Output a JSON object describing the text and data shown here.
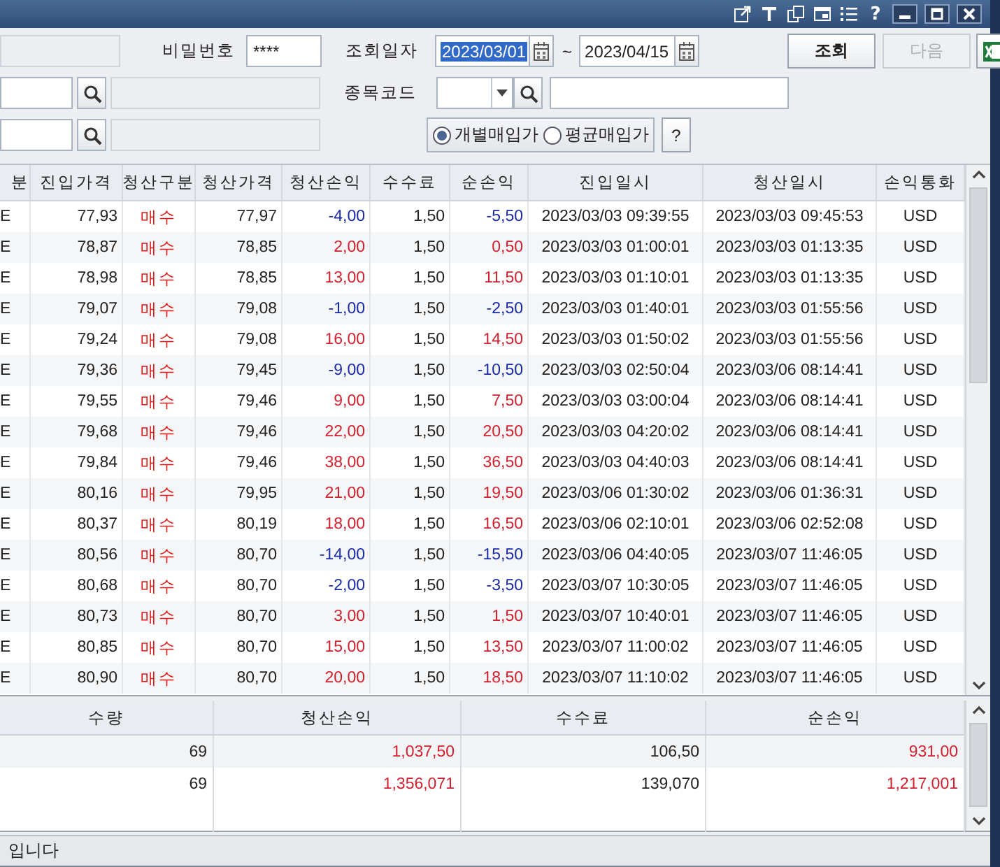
{
  "window": {
    "help": "?"
  },
  "query": {
    "password_label": "비밀번호",
    "password": "****",
    "date_label": "조회일자",
    "date_from": {
      "value": "2023/03/01",
      "highlighted": true
    },
    "date_separator": "~",
    "date_to": {
      "value": "2023/04/15",
      "highlighted": false
    },
    "search_button": "조회",
    "next_button": {
      "label": "다음",
      "disabled": true
    },
    "symbol_label": "종목코드",
    "price_options": [
      {
        "label": "개별매입가",
        "selected": true
      },
      {
        "label": "평균매입가",
        "selected": false
      }
    ],
    "help_button": "?"
  },
  "trades": {
    "columns": [
      "분",
      "진입가격",
      "청산구분",
      "청산가격",
      "청산손익",
      "수수료",
      "순손익",
      "진입일시",
      "청산일시",
      "손익통화"
    ],
    "rows": [
      {
        "cells": [
          "E",
          "77,93",
          "매수",
          "77,97",
          "-4,00",
          "1,50",
          "-5,50",
          "2023/03/03 09:39:55",
          "2023/03/03 09:45:53",
          "USD"
        ],
        "loss": true
      },
      {
        "cells": [
          "E",
          "78,87",
          "매수",
          "78,85",
          "2,00",
          "1,50",
          "0,50",
          "2023/03/03 01:00:01",
          "2023/03/03 01:13:35",
          "USD"
        ],
        "loss": false
      },
      {
        "cells": [
          "E",
          "78,98",
          "매수",
          "78,85",
          "13,00",
          "1,50",
          "11,50",
          "2023/03/03 01:10:01",
          "2023/03/03 01:13:35",
          "USD"
        ],
        "loss": false
      },
      {
        "cells": [
          "E",
          "79,07",
          "매수",
          "79,08",
          "-1,00",
          "1,50",
          "-2,50",
          "2023/03/03 01:40:01",
          "2023/03/03 01:55:56",
          "USD"
        ],
        "loss": true
      },
      {
        "cells": [
          "E",
          "79,24",
          "매수",
          "79,08",
          "16,00",
          "1,50",
          "14,50",
          "2023/03/03 01:50:02",
          "2023/03/03 01:55:56",
          "USD"
        ],
        "loss": false
      },
      {
        "cells": [
          "E",
          "79,36",
          "매수",
          "79,45",
          "-9,00",
          "1,50",
          "-10,50",
          "2023/03/03 02:50:04",
          "2023/03/06 08:14:41",
          "USD"
        ],
        "loss": true
      },
      {
        "cells": [
          "E",
          "79,55",
          "매수",
          "79,46",
          "9,00",
          "1,50",
          "7,50",
          "2023/03/03 03:00:04",
          "2023/03/06 08:14:41",
          "USD"
        ],
        "loss": false
      },
      {
        "cells": [
          "E",
          "79,68",
          "매수",
          "79,46",
          "22,00",
          "1,50",
          "20,50",
          "2023/03/03 04:20:02",
          "2023/03/06 08:14:41",
          "USD"
        ],
        "loss": false
      },
      {
        "cells": [
          "E",
          "79,84",
          "매수",
          "79,46",
          "38,00",
          "1,50",
          "36,50",
          "2023/03/03 04:40:03",
          "2023/03/06 08:14:41",
          "USD"
        ],
        "loss": false
      },
      {
        "cells": [
          "E",
          "80,16",
          "매수",
          "79,95",
          "21,00",
          "1,50",
          "19,50",
          "2023/03/06 01:30:02",
          "2023/03/06 01:36:31",
          "USD"
        ],
        "loss": false
      },
      {
        "cells": [
          "E",
          "80,37",
          "매수",
          "80,19",
          "18,00",
          "1,50",
          "16,50",
          "2023/03/06 02:10:01",
          "2023/03/06 02:52:08",
          "USD"
        ],
        "loss": false
      },
      {
        "cells": [
          "E",
          "80,56",
          "매수",
          "80,70",
          "-14,00",
          "1,50",
          "-15,50",
          "2023/03/06 04:40:05",
          "2023/03/07 11:46:05",
          "USD"
        ],
        "loss": true
      },
      {
        "cells": [
          "E",
          "80,68",
          "매수",
          "80,70",
          "-2,00",
          "1,50",
          "-3,50",
          "2023/03/07 10:30:05",
          "2023/03/07 11:46:05",
          "USD"
        ],
        "loss": true
      },
      {
        "cells": [
          "E",
          "80,73",
          "매수",
          "80,70",
          "3,00",
          "1,50",
          "1,50",
          "2023/03/07 10:40:01",
          "2023/03/07 11:46:05",
          "USD"
        ],
        "loss": false
      },
      {
        "cells": [
          "E",
          "80,85",
          "매수",
          "80,70",
          "15,00",
          "1,50",
          "13,50",
          "2023/03/07 11:00:02",
          "2023/03/07 11:46:05",
          "USD"
        ],
        "loss": false
      },
      {
        "cells": [
          "E",
          "80,90",
          "매수",
          "80,70",
          "20,00",
          "1,50",
          "18,50",
          "2023/03/07 11:10:02",
          "2023/03/07 11:46:05",
          "USD"
        ],
        "loss": false
      }
    ]
  },
  "summary": {
    "columns": [
      "수량",
      "청산손익",
      "수수료",
      "순손익"
    ],
    "rows": [
      {
        "cells": [
          "69",
          "1,037,50",
          "106,50",
          "931,00"
        ]
      },
      {
        "cells": [
          "69",
          "1,356,071",
          "139,070",
          "1,217,001"
        ]
      }
    ]
  },
  "status_bar": "입니다"
}
